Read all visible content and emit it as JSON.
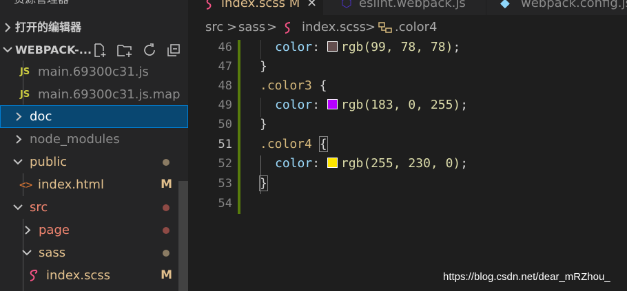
{
  "sidebar": {
    "explorer_title": "资源管理器",
    "open_editors": "打开的编辑器",
    "workspace": "WEBPACK-...",
    "tree": [
      {
        "label": "main.69300c31.js",
        "type": "js",
        "icon": "JS"
      },
      {
        "label": "main.69300c31.js.map",
        "type": "js",
        "icon": "JS"
      },
      {
        "label": "doc",
        "type": "folder"
      },
      {
        "label": "node_modules",
        "type": "folder"
      },
      {
        "label": "public",
        "type": "folder"
      },
      {
        "label": "index.html",
        "type": "html",
        "badge": "M"
      },
      {
        "label": "src",
        "type": "folder"
      },
      {
        "label": "page",
        "type": "folder"
      },
      {
        "label": "sass",
        "type": "folder"
      },
      {
        "label": "index.scss",
        "type": "scss",
        "badge": "M"
      }
    ]
  },
  "tabs": [
    {
      "label": "index.scss M",
      "active": true
    },
    {
      "label": "eslint.webpack.js",
      "active": false
    },
    {
      "label": "webpack.config.js",
      "active": false
    }
  ],
  "breadcrumb": {
    "parts": [
      "src",
      "sass",
      "index.scss",
      ".color4"
    ],
    "sep": ">"
  },
  "editor": {
    "lines": [
      {
        "n": "46",
        "indent": true,
        "prop": "color",
        "colon": ":",
        "value": "rgb(99, 78, 78)",
        "swatch": "#634e4e"
      },
      {
        "n": "47",
        "brace": "}"
      },
      {
        "n": "48",
        "selector": ".color3",
        "open": "{"
      },
      {
        "n": "49",
        "indent": true,
        "prop": "color",
        "colon": ":",
        "value": "rgb(183, 0, 255)",
        "swatch": "#b700ff"
      },
      {
        "n": "50",
        "brace": "}"
      },
      {
        "n": "51",
        "selector": ".color4",
        "open": "{",
        "current": true
      },
      {
        "n": "52",
        "indent": true,
        "prop": "color",
        "colon": ":",
        "value": "rgb(255, 230, 0)",
        "swatch": "#ffe600"
      },
      {
        "n": "53",
        "brace": "}"
      },
      {
        "n": "54"
      }
    ]
  },
  "colors": {
    "modified": "#e2c08d",
    "untracked": "#73c991",
    "error": "#f48771",
    "selection": "#094771",
    "git_added": "#587c0c"
  },
  "watermark": "https://blog.csdn.net/dear_mRZhou_"
}
